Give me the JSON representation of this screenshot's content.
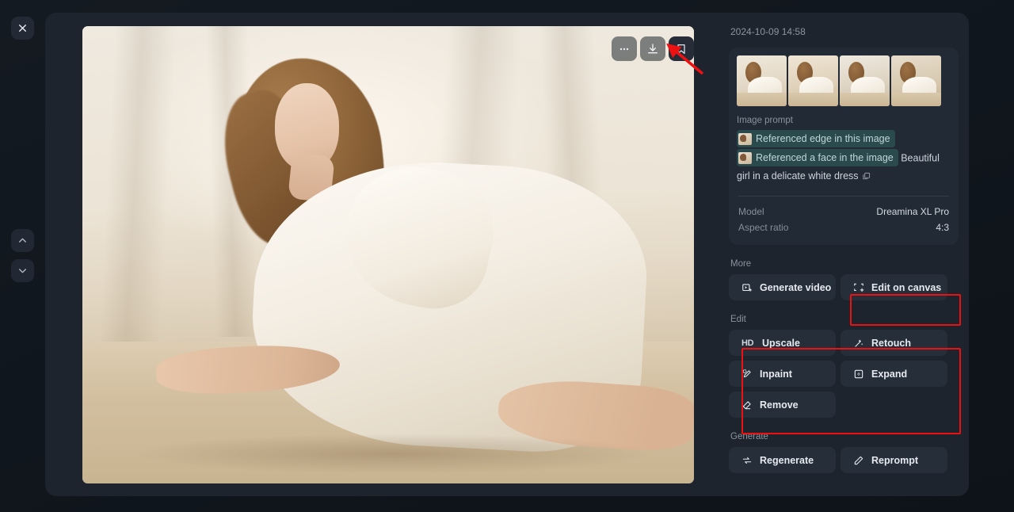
{
  "window": {
    "close_label": "close-icon",
    "nav_up": "chevron-up-icon",
    "nav_down": "chevron-down-icon"
  },
  "image_toolbar": {
    "more_label": "···",
    "download_label": "download-icon",
    "bookmark_label": "bookmark-icon"
  },
  "details": {
    "timestamp": "2024-10-09 14:58",
    "thumbnails": [
      {
        "alt": "variant-1"
      },
      {
        "alt": "variant-2"
      },
      {
        "alt": "variant-3"
      },
      {
        "alt": "variant-4"
      }
    ],
    "prompt_label": "Image prompt",
    "reference_chips": [
      "Referenced edge in this image",
      "Referenced a face in the image"
    ],
    "prompt_text": "Beautiful girl in a delicate white dress",
    "meta": [
      {
        "key": "Model",
        "value": "Dreamina XL Pro"
      },
      {
        "key": "Aspect ratio",
        "value": "4:3"
      }
    ]
  },
  "sections": [
    {
      "label": "More",
      "items": [
        {
          "label": "Generate video",
          "icon": "video-icon"
        },
        {
          "label": "Edit on canvas",
          "icon": "canvas-icon",
          "highlighted": true
        }
      ]
    },
    {
      "label": "Edit",
      "highlighted": true,
      "items": [
        {
          "label": "Upscale",
          "icon": "hd-icon"
        },
        {
          "label": "Retouch",
          "icon": "wand-icon"
        },
        {
          "label": "Inpaint",
          "icon": "brush-icon"
        },
        {
          "label": "Expand",
          "icon": "expand-icon"
        },
        {
          "label": "Remove",
          "icon": "eraser-icon"
        }
      ]
    },
    {
      "label": "Generate",
      "items": [
        {
          "label": "Regenerate",
          "icon": "refresh-icon"
        },
        {
          "label": "Reprompt",
          "icon": "pencil-icon"
        }
      ]
    }
  ],
  "annotations": {
    "arrow_target": "download-icon",
    "highlight_color": "#ee1111"
  }
}
